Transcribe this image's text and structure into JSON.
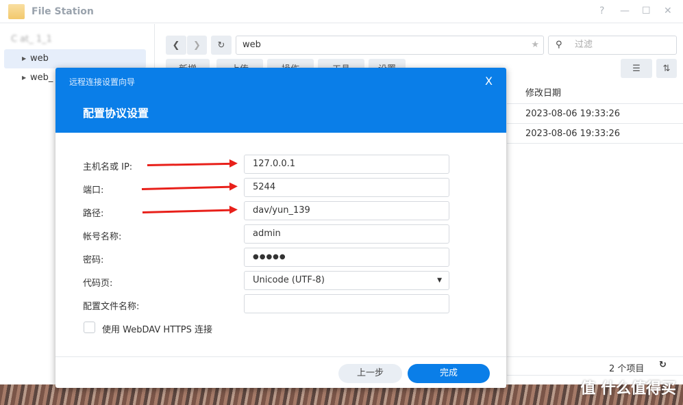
{
  "window": {
    "title": "File Station",
    "help": "?",
    "minimize": "—",
    "maximize": "☐",
    "close": "✕"
  },
  "sidebar": {
    "root": "C  at_  1_1",
    "items": [
      {
        "label": "web"
      },
      {
        "label": "web_"
      }
    ]
  },
  "toolbar": {
    "back": "❮",
    "forward": "❯",
    "refresh": "↻",
    "path": "web",
    "star": "★",
    "filter_placeholder": "过滤",
    "buttons": [
      "新增",
      "上传",
      "操作",
      "工具",
      "设置"
    ],
    "list_view": "☰",
    "sort": "⇅"
  },
  "table": {
    "column": "修改日期",
    "rows": [
      "2023-08-06 19:33:26",
      "2023-08-06 19:33:26"
    ]
  },
  "status": {
    "count": "2 个项目",
    "refresh": "↻"
  },
  "dialog": {
    "wizard": "远程连接设置向导",
    "step_title": "配置协议设置",
    "close": "X",
    "fields": [
      {
        "label": "主机名或 IP:",
        "value": "127.0.0.1"
      },
      {
        "label": "端口:",
        "value": "5244"
      },
      {
        "label": "路径:",
        "value": "dav/yun_139"
      },
      {
        "label": "帐号名称:",
        "value": "admin"
      },
      {
        "label": "密码:",
        "value": "●●●●●"
      },
      {
        "label": "代码页:",
        "value": "Unicode (UTF-8)"
      },
      {
        "label": "配置文件名称:",
        "value": ""
      }
    ],
    "https_checkbox": {
      "label": "使用 WebDAV HTTPS 连接",
      "checked": false
    },
    "back_button": "上一步",
    "finish_button": "完成"
  },
  "watermark": "值 什么值得买",
  "colors": {
    "accent": "#0a7ee8",
    "arrow": "#e8201a"
  }
}
